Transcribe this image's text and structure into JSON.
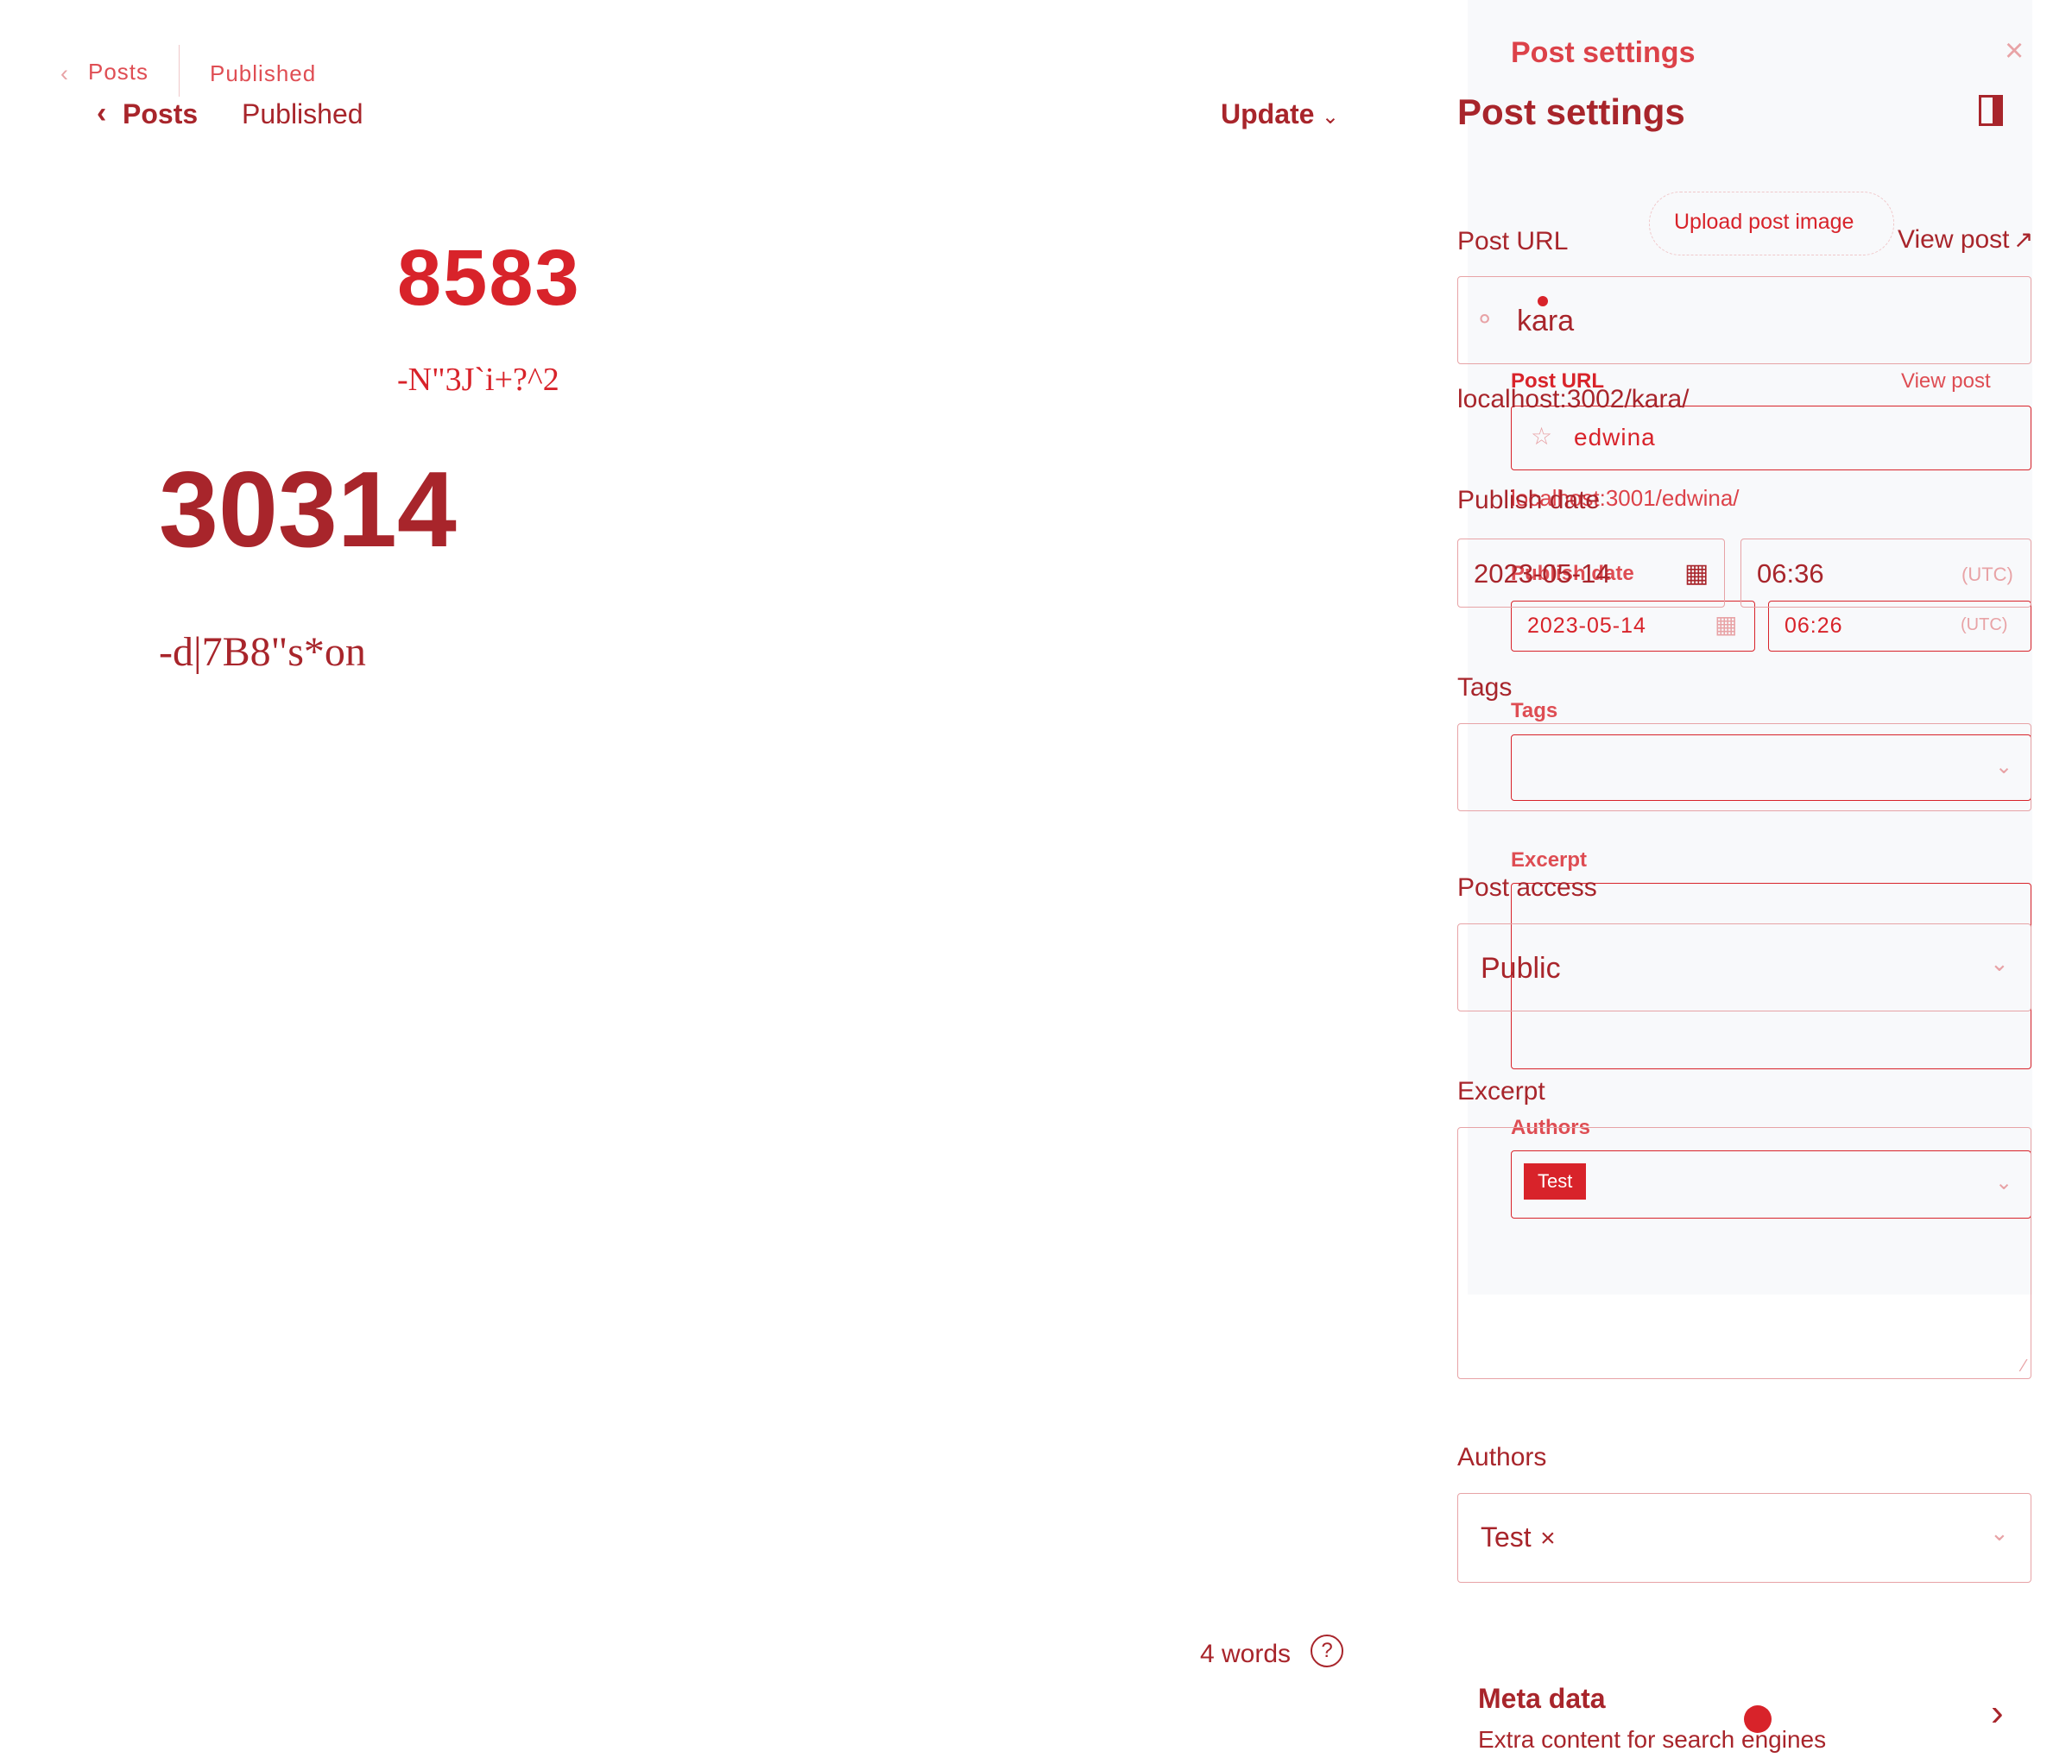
{
  "ghost": {
    "nav_back": "Posts",
    "status": "Published",
    "panel_title": "Post settings",
    "upload_image": "Upload post image",
    "url_label": "Post URL",
    "view_post": "View post",
    "slug": "edwina",
    "url_preview": "localhost:3001/edwina/",
    "publish_label": "Publish date",
    "date": "2023-05-14",
    "time": "06:26",
    "tz": "(UTC)",
    "tags_label": "Tags",
    "excerpt_label": "Excerpt",
    "authors_label": "Authors",
    "author_chip": "Test",
    "title": "8583",
    "body": "-N\"3J`i+?^2"
  },
  "editor": {
    "nav_back": "Posts",
    "status": "Published",
    "update_button": "Update",
    "title": "30314",
    "body": "-d|7B8\"s*on",
    "word_count": "4 words"
  },
  "panel": {
    "title": "Post settings",
    "url_label": "Post URL",
    "view_post": "View post",
    "slug": "kara",
    "url_preview": "localhost:3002/kara/",
    "publish_label": "Publish date",
    "date": "2023-05-14",
    "time": "06:36",
    "tz": "(UTC)",
    "tags_label": "Tags",
    "access_label": "Post access",
    "access_value": "Public",
    "excerpt_label": "Excerpt",
    "authors_label": "Authors",
    "author_chip": "Test",
    "author_remove": "×",
    "meta_title": "Meta data",
    "meta_desc": "Extra content for search engines"
  },
  "colors": {
    "accent": "#d8232a",
    "dark_accent": "#a8252b",
    "faint": "#e8a3a6"
  }
}
